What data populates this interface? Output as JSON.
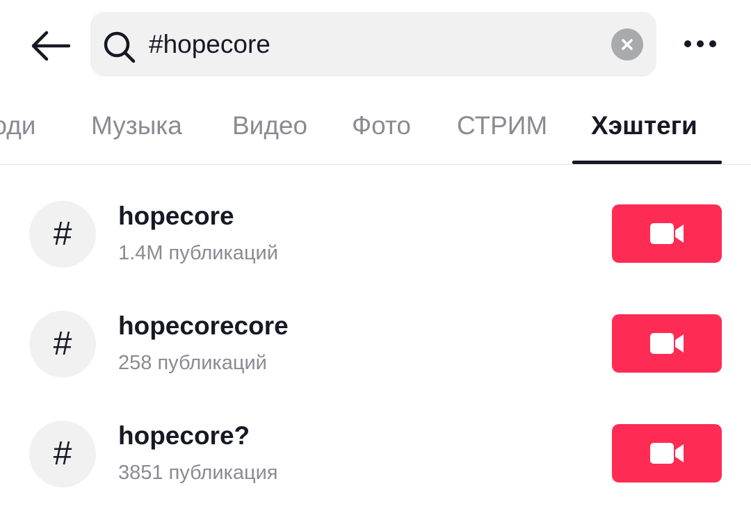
{
  "search": {
    "value": "#hopecore",
    "icon": "search-icon"
  },
  "tabs": [
    {
      "label": "Люди",
      "active": false
    },
    {
      "label": "Музыка",
      "active": false
    },
    {
      "label": "Видео",
      "active": false
    },
    {
      "label": "Фото",
      "active": false
    },
    {
      "label": "СТРИМ",
      "active": false
    },
    {
      "label": "Хэштеги",
      "active": true
    }
  ],
  "hashtags": [
    {
      "symbol": "#",
      "name": "hopecore",
      "count": "1.4M публикаций"
    },
    {
      "symbol": "#",
      "name": "hopecorecore",
      "count": "258 публикаций"
    },
    {
      "symbol": "#",
      "name": "hopecore?",
      "count": "3851 публикация"
    }
  ],
  "colors": {
    "accent": "#fe2c55",
    "search_bg": "#f1f1f2",
    "muted_text": "#8a8b91",
    "primary_text": "#161823"
  },
  "icons": {
    "back": "arrow-left-icon",
    "clear": "clear-x-icon",
    "more": "more-dots-icon",
    "record": "video-camera-icon",
    "hashtag": "hashtag-icon"
  }
}
